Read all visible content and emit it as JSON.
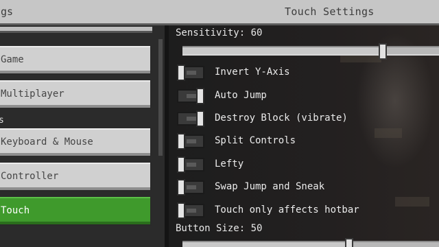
{
  "titlebar": {
    "left_title": "ngs",
    "right_title": "Touch Settings"
  },
  "sidebar": {
    "buttons": [
      {
        "label": "Game"
      },
      {
        "label": "Multiplayer"
      },
      {
        "label": "Keyboard & Mouse"
      },
      {
        "label": "Controller"
      },
      {
        "label": "Touch",
        "selected": true
      }
    ],
    "section_label": "s"
  },
  "content": {
    "sensitivity": {
      "label": "Sensitivity: 60",
      "value": 60,
      "range": [
        0,
        100
      ]
    },
    "toggles": [
      {
        "label": "Invert Y-Axis",
        "on": false
      },
      {
        "label": "Auto Jump",
        "on": true
      },
      {
        "label": "Destroy Block (vibrate)",
        "on": true
      },
      {
        "label": "Split Controls",
        "on": false
      },
      {
        "label": "Lefty",
        "on": false
      },
      {
        "label": "Swap Jump and Sneak",
        "on": false
      },
      {
        "label": "Touch only affects hotbar",
        "on": false
      }
    ],
    "button_size": {
      "label": "Button Size: 50",
      "value": 50,
      "range": [
        0,
        100
      ]
    }
  },
  "colors": {
    "selected": "#3f9a2c",
    "panel": "#c6c6c6",
    "background": "#1c1c1c"
  }
}
